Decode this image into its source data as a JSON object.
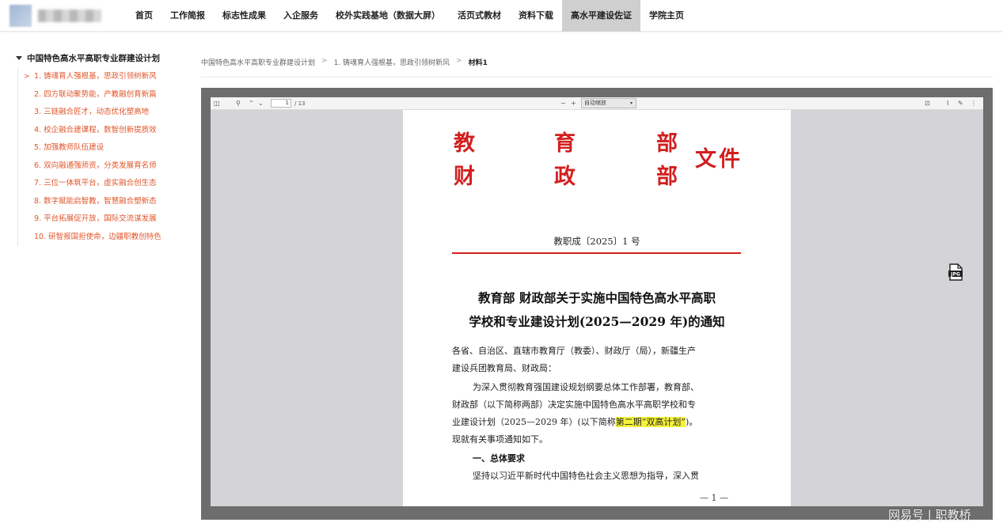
{
  "nav": {
    "items": [
      {
        "label": "首页"
      },
      {
        "label": "工作简报"
      },
      {
        "label": "标志性成果"
      },
      {
        "label": "入企服务"
      },
      {
        "label": "校外实践基地（数据大屏）"
      },
      {
        "label": "活页式教材"
      },
      {
        "label": "资料下载"
      },
      {
        "label": "高水平建设佐证",
        "active": true
      },
      {
        "label": "学院主页"
      }
    ]
  },
  "sidebar": {
    "title": "中国特色高水平高职专业群建设计划",
    "items": [
      {
        "label": "1. 铸魂育人强根基，思政引领树新风",
        "current": true
      },
      {
        "label": "2. 四方联动聚势能，产教融创育新篇"
      },
      {
        "label": "3. 三链融合匠才，动态优化塑高地"
      },
      {
        "label": "4. 校企融合建课程，数智创新提质效"
      },
      {
        "label": "5. 加强教师队伍建设"
      },
      {
        "label": "6. 双向融通强师资，分类发展育名师"
      },
      {
        "label": "7. 三位一体筑平台，虚实融合创生态"
      },
      {
        "label": "8. 数字赋能启智教，智慧融合塑新态"
      },
      {
        "label": "9. 平台拓展促开放，国际交流谋发展"
      },
      {
        "label": "10. 研智报国担使命，边疆职教创特色"
      }
    ]
  },
  "breadcrumb": {
    "items": [
      "中国特色高水平高职专业群建设计划",
      "1. 铸魂育人强根基，思政引领树新风",
      "材料1"
    ]
  },
  "viewer": {
    "page_input": "1",
    "page_total": "/ 13",
    "zoom": "自动缩放"
  },
  "document": {
    "header_chars": [
      "教",
      "育",
      "部",
      "财",
      "政",
      "部"
    ],
    "header_suffix": "文件",
    "doc_number": "教职成〔2025〕1 号",
    "title_line1": "教育部 财政部关于实施中国特色高水平高职",
    "title_line2": "学校和专业建设计划(2025—2029 年)的通知",
    "addressee_line1": "各省、自治区、直辖市教育厅（教委）、财政厅（局），新疆生产",
    "addressee_line2": "建设兵团教育局、财政局：",
    "body_line1": "为深入贯彻教育强国建设规划纲要总体工作部署，教育部、",
    "body_line2": "财政部（以下简称两部）决定实施中国特色高水平高职学校和专",
    "body_line3_pre": "业建设计划（2025—2029 年）(以下简称",
    "body_line3_hl": "第二期“双高计划”",
    "body_line3_post": ")。",
    "body_line4": "现就有关事项通知如下。",
    "section1": "一、总体要求",
    "body_line5": "坚持以习近平新时代中国特色社会主义思想为指导，深入贯",
    "page_number": "— 1 —"
  },
  "watermark": "网易号 | 职教桥",
  "colors": {
    "accent_red": "#d21f1f",
    "sidebar_link": "#e0562a",
    "nav_active_bg": "#cfcfcf",
    "highlight": "#f5f23a"
  }
}
